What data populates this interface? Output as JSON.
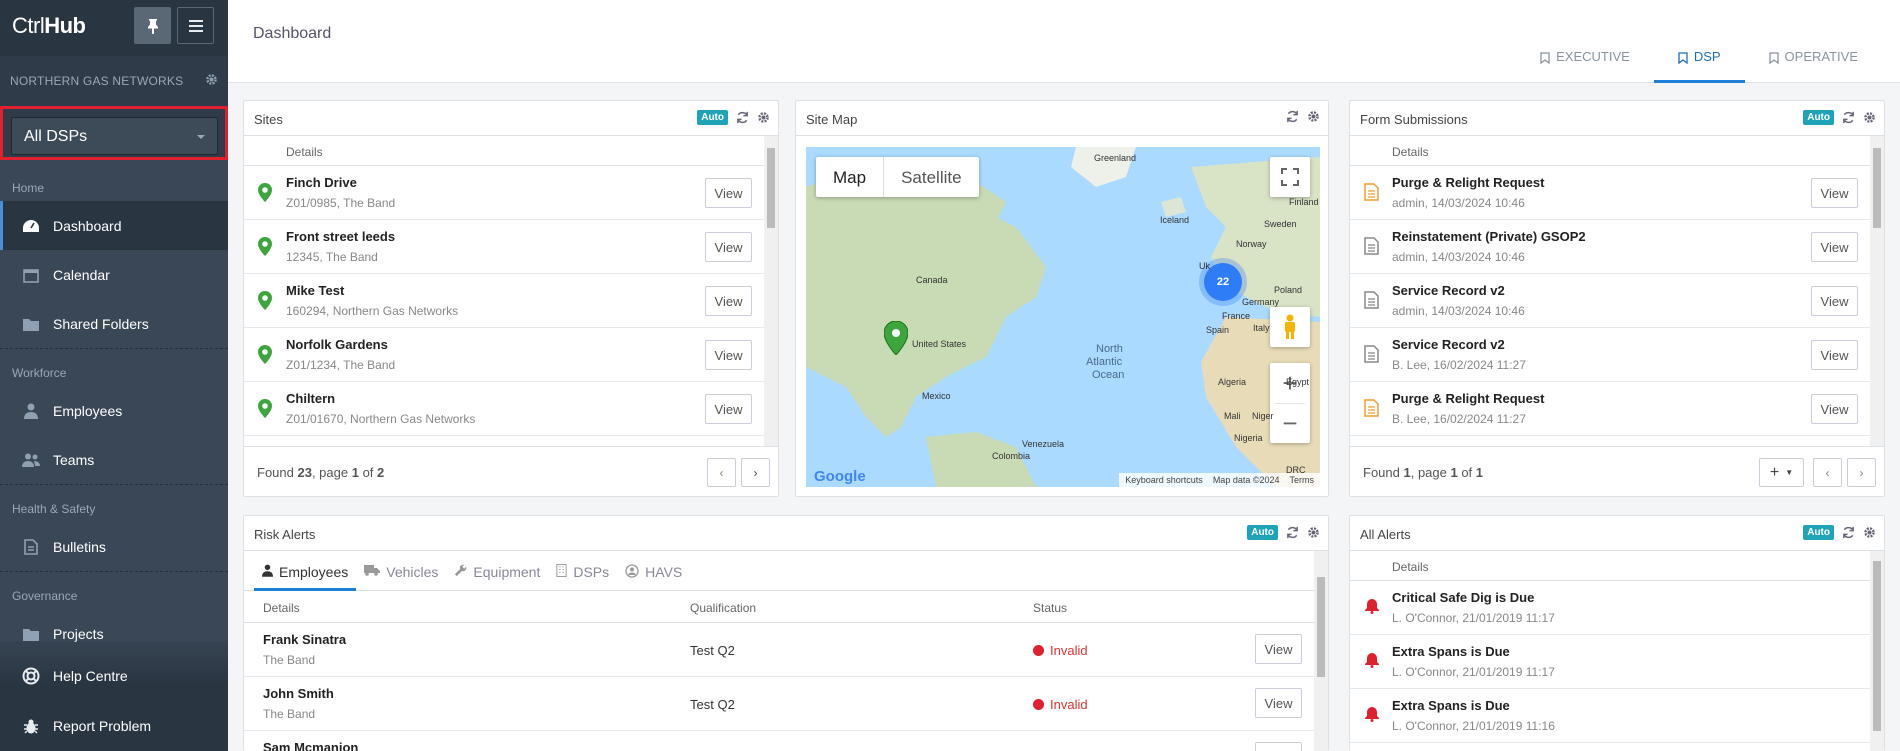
{
  "brand": {
    "name_light": "Ctrl",
    "name_bold": "Hub"
  },
  "org": {
    "name": "NORTHERN GAS NETWORKS"
  },
  "dsp_select": {
    "value": "All DSPs"
  },
  "sidebar": {
    "sections": [
      {
        "label": "Home",
        "items": [
          {
            "label": "Dashboard",
            "icon": "dashboard-icon",
            "active": true
          },
          {
            "label": "Calendar",
            "icon": "calendar-icon"
          },
          {
            "label": "Shared Folders",
            "icon": "folder-icon"
          }
        ]
      },
      {
        "label": "Workforce",
        "items": [
          {
            "label": "Employees",
            "icon": "user-icon"
          },
          {
            "label": "Teams",
            "icon": "users-icon"
          }
        ]
      },
      {
        "label": "Health & Safety",
        "items": [
          {
            "label": "Bulletins",
            "icon": "document-icon"
          }
        ]
      },
      {
        "label": "Governance",
        "items": [
          {
            "label": "Projects",
            "icon": "folder-icon"
          }
        ]
      }
    ],
    "bottom": [
      {
        "label": "Help Centre",
        "icon": "lifebuoy-icon"
      },
      {
        "label": "Report Problem",
        "icon": "bug-icon"
      }
    ]
  },
  "header": {
    "title": "Dashboard",
    "tabs": [
      {
        "label": "EXECUTIVE"
      },
      {
        "label": "DSP",
        "active": true
      },
      {
        "label": "OPERATIVE"
      }
    ]
  },
  "sites": {
    "title": "Sites",
    "auto": "Auto",
    "col": "Details",
    "view": "View",
    "rows": [
      {
        "name": "Finch Drive",
        "sub": "Z01/0985, The Band"
      },
      {
        "name": "Front street leeds",
        "sub": "12345, The Band"
      },
      {
        "name": "Mike Test",
        "sub": "160294, Northern Gas Networks"
      },
      {
        "name": "Norfolk Gardens",
        "sub": "Z01/1234, The Band"
      },
      {
        "name": "Chiltern",
        "sub": "Z01/01670, Northern Gas Networks"
      }
    ],
    "footer": {
      "found": "Found ",
      "count": "23",
      "page_txt": ", page ",
      "page": "1",
      "of": " of ",
      "pages": "2"
    }
  },
  "sitemap": {
    "title": "Site Map",
    "map_btn": "Map",
    "sat_btn": "Satellite",
    "cluster": "22",
    "labels": {
      "greenland": "Greenland",
      "finland": "Finland",
      "iceland": "Iceland",
      "sweden": "Sweden",
      "norway": "Norway",
      "canada": "Canada",
      "uk": "Uk",
      "poland": "Poland",
      "germany": "Germany",
      "france": "France",
      "spain": "Spain",
      "italy": "Italy",
      "us": "United States",
      "ocean1": "North",
      "ocean2": "Atlantic",
      "ocean3": "Ocean",
      "algeria": "Algeria",
      "egypt": "Egypt",
      "mexico": "Mexico",
      "mali": "Mali",
      "niger": "Niger",
      "venezuela": "Venezuela",
      "colombia": "Colombia",
      "nigeria": "Nigeria",
      "drc": "DRC"
    },
    "attr": {
      "keyboard": "Keyboard shortcuts",
      "mapdata": "Map data ©2024",
      "terms": "Terms",
      "google": "Google"
    }
  },
  "forms": {
    "title": "Form Submissions",
    "auto": "Auto",
    "col": "Details",
    "view": "View",
    "rows": [
      {
        "name": "Purge & Relight Request",
        "sub": "admin, 14/03/2024 10:46",
        "color": "#f0a030"
      },
      {
        "name": "Reinstatement (Private) GSOP2",
        "sub": "admin, 14/03/2024 10:46",
        "color": "#888888"
      },
      {
        "name": "Service Record v2",
        "sub": "admin, 14/03/2024 10:46",
        "color": "#888888"
      },
      {
        "name": "Service Record v2",
        "sub": "B. Lee, 16/02/2024 11:27",
        "color": "#888888"
      },
      {
        "name": "Purge & Relight Request",
        "sub": "B. Lee, 16/02/2024 11:27",
        "color": "#f0a030"
      }
    ],
    "footer": {
      "found": "Found ",
      "count": "1",
      "page_txt": ", page ",
      "page": "1",
      "of": " of ",
      "pages": "1"
    }
  },
  "risk": {
    "title": "Risk Alerts",
    "auto": "Auto",
    "tabs": [
      {
        "label": "Employees",
        "active": true
      },
      {
        "label": "Vehicles"
      },
      {
        "label": "Equipment"
      },
      {
        "label": "DSPs"
      },
      {
        "label": "HAVS"
      }
    ],
    "cols": {
      "details": "Details",
      "qual": "Qualification",
      "status": "Status"
    },
    "view": "View",
    "rows": [
      {
        "name": "Frank Sinatra",
        "sub": "The Band",
        "qual": "Test Q2",
        "status": "Invalid"
      },
      {
        "name": "John Smith",
        "sub": "The Band",
        "qual": "Test Q2",
        "status": "Invalid"
      },
      {
        "name": "Sam Mcmanion",
        "sub": "",
        "qual": "",
        "status": ""
      }
    ]
  },
  "alerts": {
    "title": "All Alerts",
    "auto": "Auto",
    "col": "Details",
    "rows": [
      {
        "name": "Critical Safe Dig is Due",
        "sub": "L. O'Connor, 21/01/2019 11:17"
      },
      {
        "name": "Extra Spans is Due",
        "sub": "L. O'Connor, 21/01/2019 11:17"
      },
      {
        "name": "Extra Spans is Due",
        "sub": "L. O'Connor, 21/01/2019 11:16"
      }
    ]
  }
}
